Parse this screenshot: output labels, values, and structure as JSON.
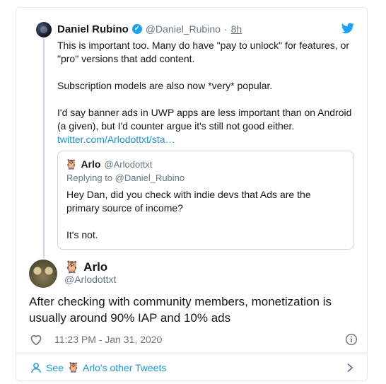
{
  "parent": {
    "name": "Daniel Rubino",
    "handle": "@Daniel_Rubino",
    "dot": "·",
    "time": "8h",
    "verified": true,
    "paragraphs": [
      "This is important too. Many do have \"pay to unlock\" for features, or \"pro\" versions that add content.",
      "Subscription models are also now *very* popular.",
      "I'd say banner ads in UWP apps are less important than on Android (a given), but I'd counter argue it's still not good either."
    ],
    "link": "twitter.com/Arlodottxt/sta…"
  },
  "quote": {
    "emoji": "🦉",
    "name": "Arlo",
    "handle": "@Arlodottxt",
    "replying_to": "Replying to @Daniel_Rubino",
    "paragraphs": [
      "Hey Dan, did you check with indie devs that Ads are the primary source of income?",
      "It's not."
    ]
  },
  "main": {
    "emoji": "🦉",
    "name": "Arlo",
    "handle": "@Arlodottxt",
    "text": "After checking with community members, monetization is usually around 90% IAP and 10% ads",
    "time": "11:23 PM - Jan 31, 2020"
  },
  "footer": {
    "see": "See",
    "emoji": "🦉",
    "other": "Arlo's other Tweets"
  },
  "colors": {
    "link": "#1b95e0",
    "muted": "#657786",
    "twitter_blue": "#1da1f2",
    "border": "#e1e8ed"
  }
}
